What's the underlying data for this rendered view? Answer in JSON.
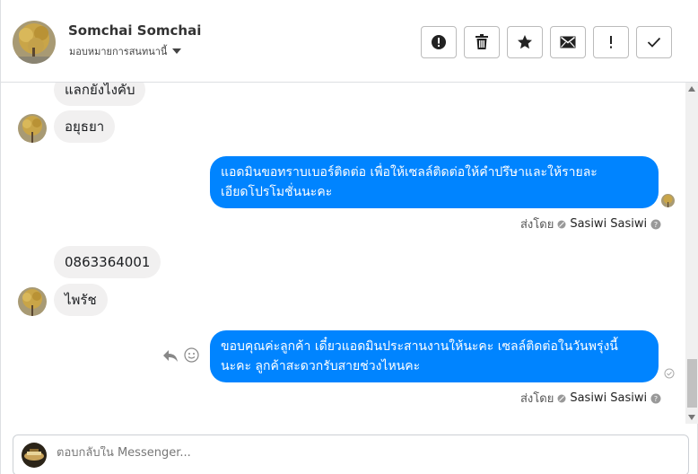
{
  "header": {
    "contact_name": "Somchai Somchai",
    "assign_label": "มอบหมายการสนทนานี้",
    "actions": [
      {
        "icon": "alert-circle-icon",
        "name": "mark-spam-button"
      },
      {
        "icon": "trash-icon",
        "name": "delete-button"
      },
      {
        "icon": "star-icon",
        "name": "star-button"
      },
      {
        "icon": "envelope-icon",
        "name": "mark-unread-button"
      },
      {
        "icon": "exclamation-icon",
        "name": "follow-up-button"
      },
      {
        "icon": "checkmark-icon",
        "name": "mark-done-button"
      }
    ]
  },
  "messages": [
    {
      "direction": "in",
      "text": "แลกยังไงคับ"
    },
    {
      "direction": "in",
      "text": "อยุธยา"
    },
    {
      "direction": "out",
      "line1": "แอดมินขอทราบเบอร์ติดต่อ เพื่อให้เซลล์ติดต่อให้คำปรึษาและให้รายละ",
      "line2": "เอียดโปรโมชั่นนะคะ",
      "sent_label": "ส่งโดย",
      "sender": "Sasiwi Sasiwi"
    },
    {
      "direction": "in",
      "text": "0863364001"
    },
    {
      "direction": "in",
      "text": "ไพรัช"
    },
    {
      "direction": "out",
      "line1": "ขอบคุณค่ะลูกค้า เดี๋ยวแอดมินประสานงานให้นะคะ เซลล์ติดต่อในวันพรุ่งนี้",
      "line2": "นะคะ ลูกค้าสะดวกรับสายช่วงไหนคะ",
      "sent_label": "ส่งโดย",
      "sender": "Sasiwi Sasiwi"
    }
  ],
  "reply": {
    "placeholder": "ตอบกลับใน Messenger..."
  },
  "colors": {
    "outgoing_bubble": "#0084ff",
    "incoming_bubble": "#f1f0f0"
  }
}
